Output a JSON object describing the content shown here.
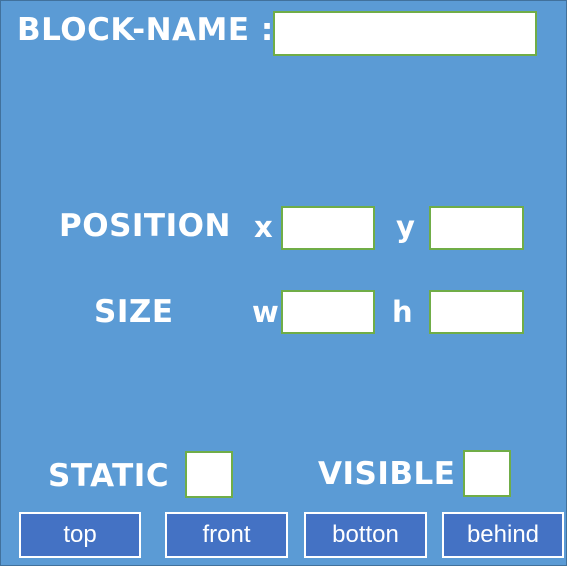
{
  "block_name": {
    "label": "BLOCK-NAME :",
    "value": ""
  },
  "position": {
    "label": "POSITION",
    "x_label": "x",
    "y_label": "y",
    "x_value": "",
    "y_value": ""
  },
  "size": {
    "label": "SIZE",
    "w_label": "w",
    "h_label": "h",
    "w_value": "",
    "h_value": ""
  },
  "static": {
    "label": "STATIC",
    "checked": false
  },
  "visible": {
    "label": "VISIBLE",
    "checked": false
  },
  "buttons": {
    "top": "top",
    "front": "front",
    "botton": "botton",
    "behind": "behind"
  },
  "colors": {
    "panel_bg": "#5b9bd5",
    "button_bg": "#4472c4",
    "field_border": "#70ad47",
    "text": "#ffffff"
  }
}
